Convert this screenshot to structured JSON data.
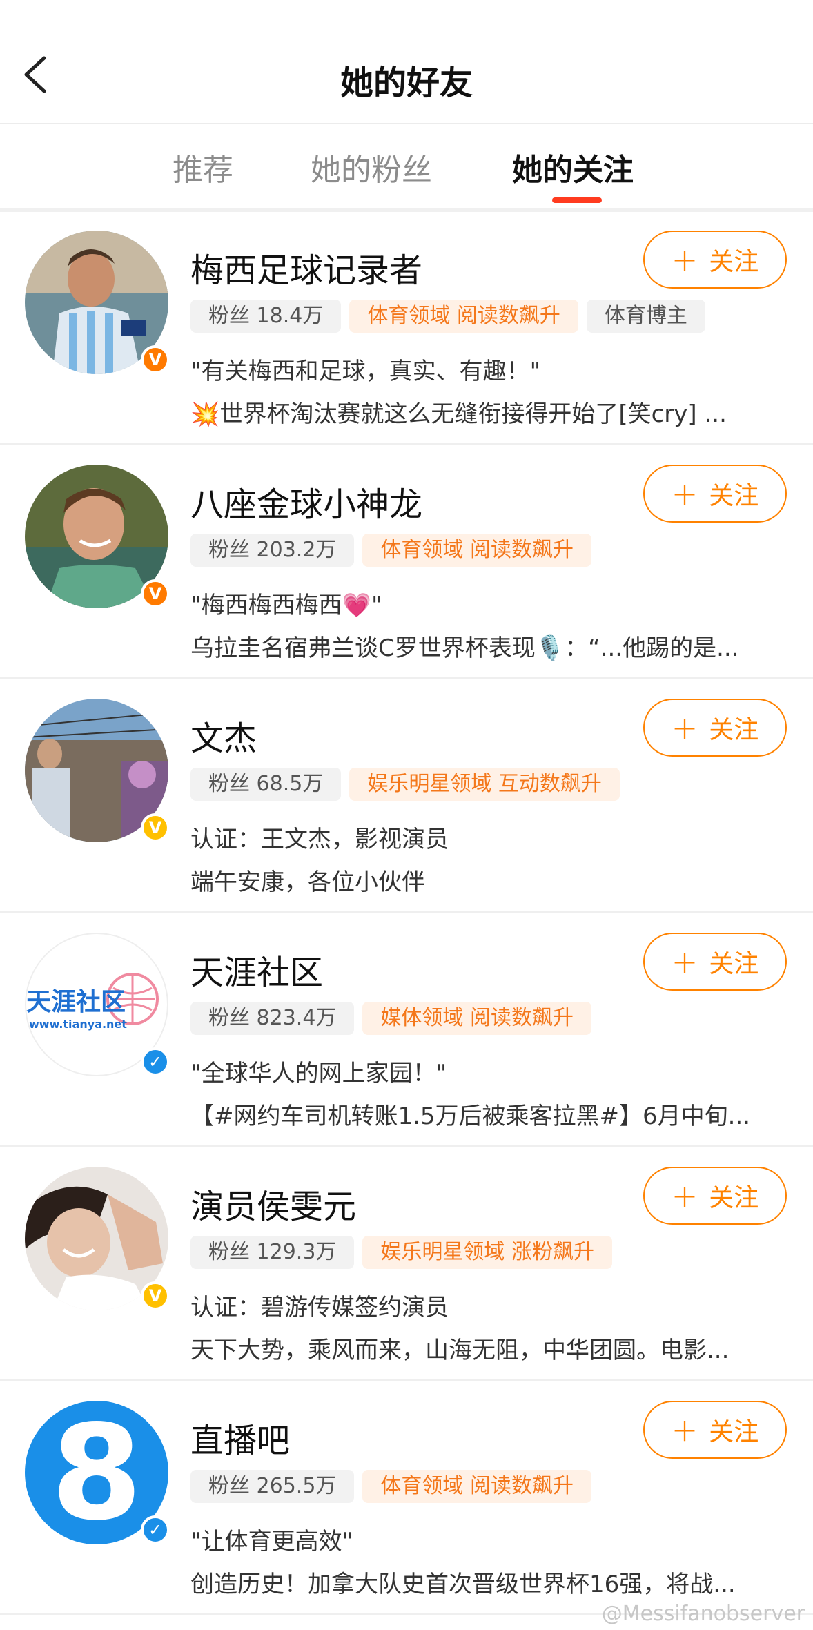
{
  "header": {
    "title": "她的好友"
  },
  "tabs": [
    {
      "label": "推荐"
    },
    {
      "label": "她的粉丝"
    },
    {
      "label": "她的关注"
    }
  ],
  "follow_label": "关注",
  "users": [
    {
      "name": "梅西足球记录者",
      "tags": [
        {
          "text": "粉丝 18.4万",
          "style": "gray"
        },
        {
          "text": "体育领域 阅读数飙升",
          "style": "orange"
        },
        {
          "text": "体育博主",
          "style": "gray"
        }
      ],
      "desc": "\"有关梅西和足球，真实、有趣！\"",
      "post": "💥世界杯淘汰赛就这么无缝衔接得开始了[笑cry] ...",
      "badge_color": "#ff7a00"
    },
    {
      "name": "八座金球小神龙",
      "tags": [
        {
          "text": "粉丝 203.2万",
          "style": "gray"
        },
        {
          "text": "体育领域 阅读数飙升",
          "style": "orange"
        }
      ],
      "desc": "\"梅西梅西梅西💗\"",
      "post": "乌拉圭名宿弗兰谈C罗世界杯表现🎙️：“...他踢的是...",
      "badge_color": "#ff7a00"
    },
    {
      "name": "文杰",
      "tags": [
        {
          "text": "粉丝 68.5万",
          "style": "gray"
        },
        {
          "text": "娱乐明星领域 互动数飙升",
          "style": "orange"
        }
      ],
      "desc": "认证：王文杰，影视演员",
      "post": "端午安康，各位小伙伴",
      "badge_color": "#ffc000"
    },
    {
      "name": "天涯社区",
      "tags": [
        {
          "text": "粉丝 823.4万",
          "style": "gray"
        },
        {
          "text": "媒体领域 阅读数飙升",
          "style": "orange"
        }
      ],
      "desc": "\"全球华人的网上家园！\"",
      "post": "【#网约车司机转账1.5万后被乘客拉黑#】6月中旬...",
      "badge_color": "#1a8fe8"
    },
    {
      "name": "演员侯雯元",
      "tags": [
        {
          "text": "粉丝 129.3万",
          "style": "gray"
        },
        {
          "text": "娱乐明星领域 涨粉飙升",
          "style": "orange"
        }
      ],
      "desc": "认证：碧游传媒签约演员",
      "post": "天下大势，乘风而来，山海无阻，中华团圆。电影...",
      "badge_color": "#ffc000"
    },
    {
      "name": "直播吧",
      "tags": [
        {
          "text": "粉丝 265.5万",
          "style": "gray"
        },
        {
          "text": "体育领域 阅读数飙升",
          "style": "orange"
        }
      ],
      "desc": "\"让体育更高效\"",
      "post": "创造历史！加拿大队史首次晋级世界杯16强，将战...",
      "badge_color": "#1a8fe8"
    }
  ],
  "avatars": {
    "tianya_logo_text": "天涯社区",
    "tianya_url": "www.tianya.net",
    "zhibo8_logo": "8"
  },
  "watermark": "@Messifanobserver"
}
